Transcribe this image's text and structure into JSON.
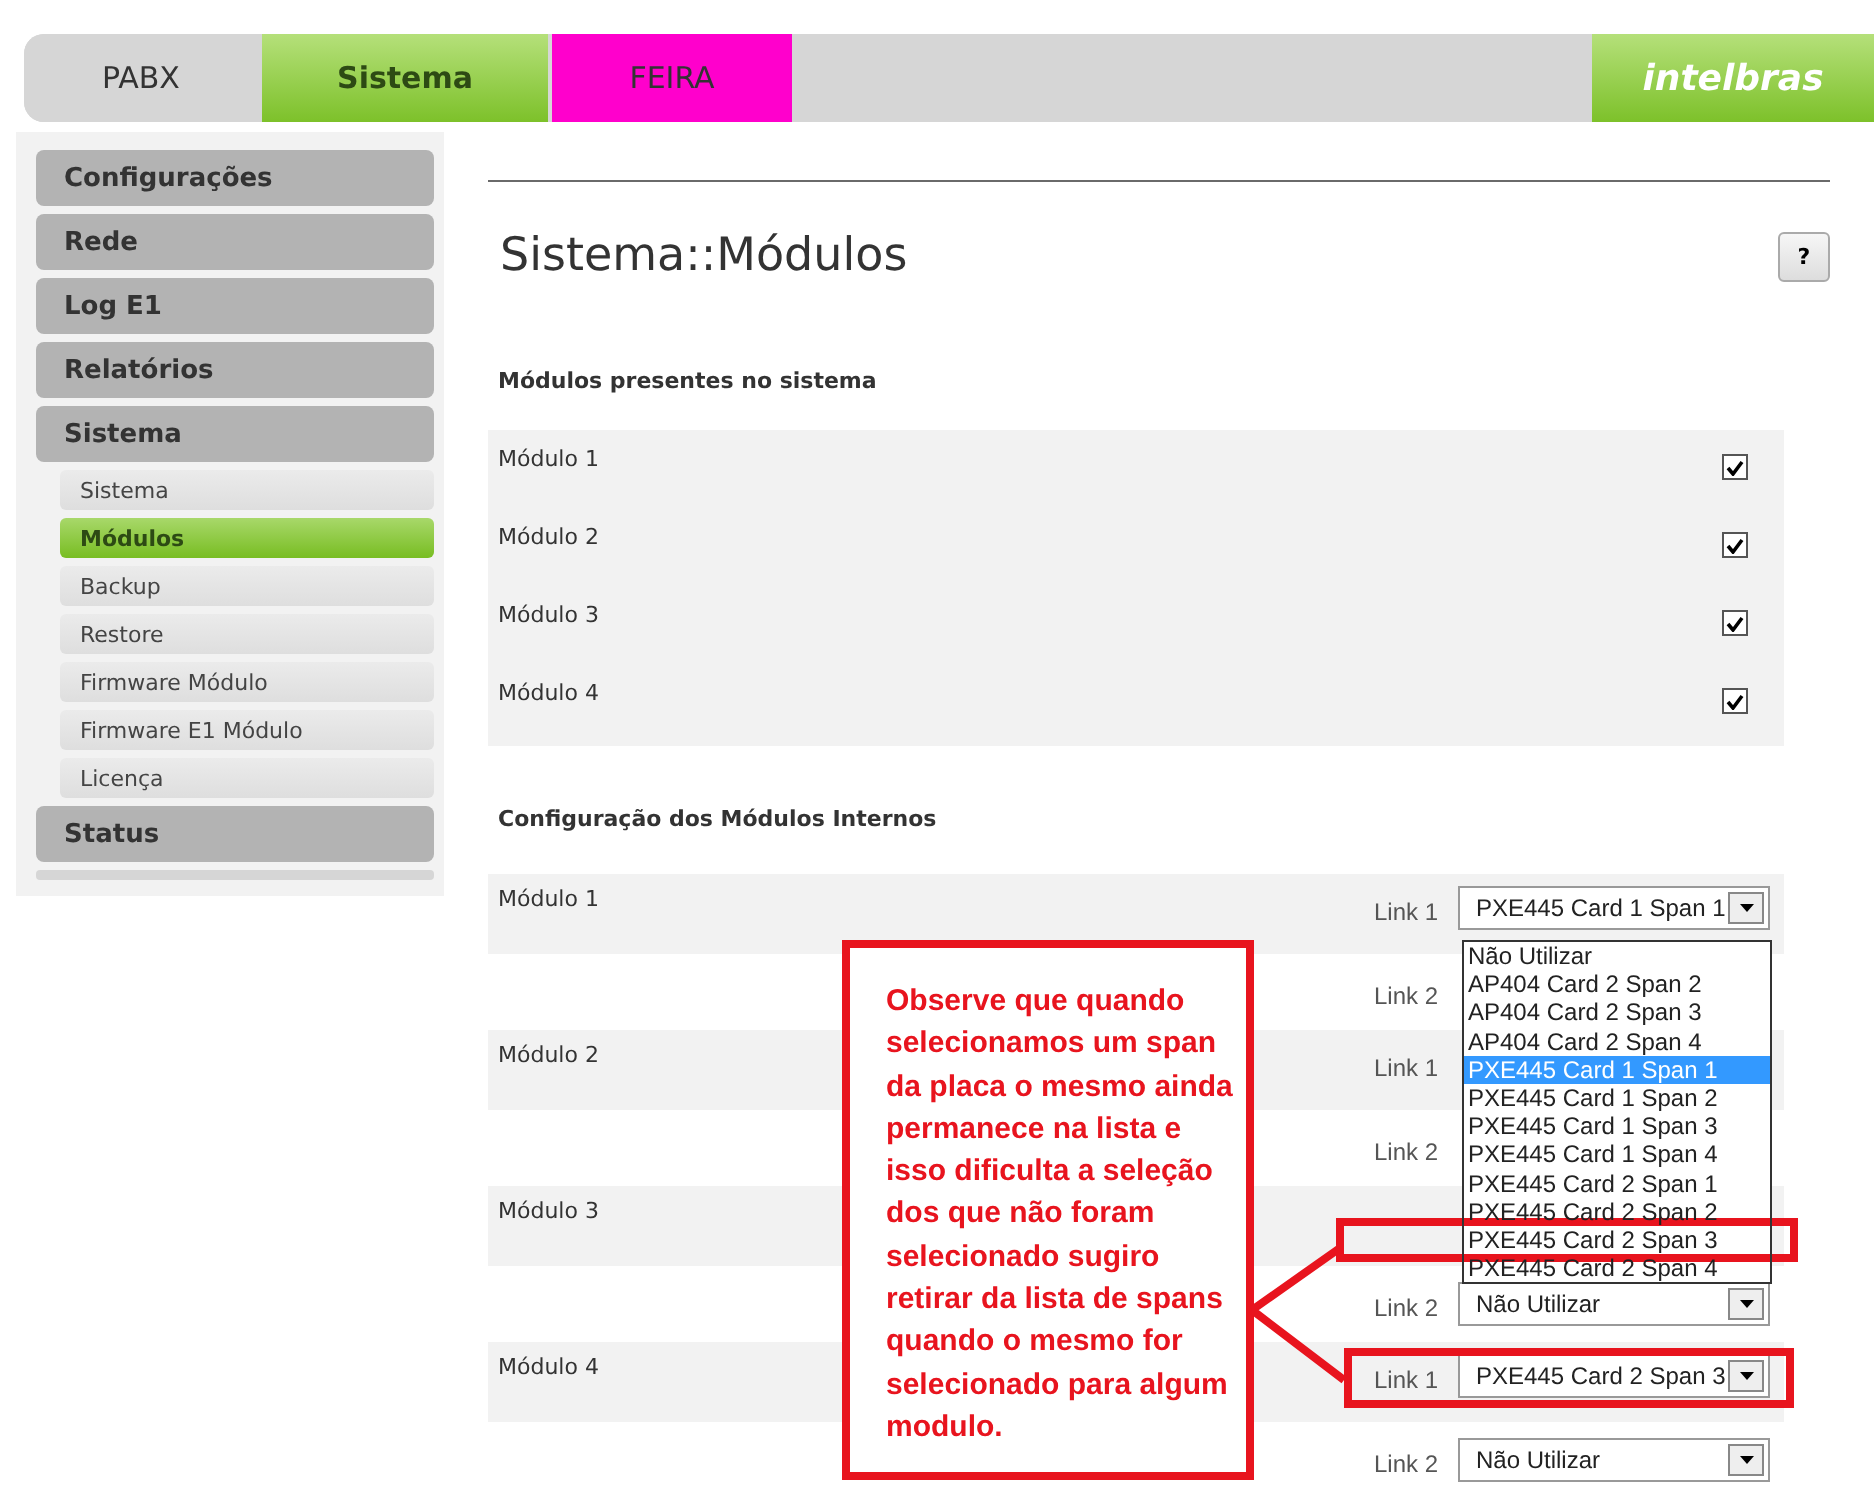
{
  "tabs": [
    {
      "label": "PABX",
      "selected": false,
      "color": "#d6d6d6"
    },
    {
      "label": "Sistema",
      "selected": true,
      "color": "#7dc12a"
    },
    {
      "label": "FEIRA",
      "selected": false,
      "color": "#ff00cc"
    }
  ],
  "logo": "intelbras",
  "sidebar": {
    "items": [
      {
        "label": "Configurações"
      },
      {
        "label": "Rede"
      },
      {
        "label": "Log E1"
      },
      {
        "label": "Relatórios"
      },
      {
        "label": "Sistema",
        "children": [
          {
            "label": "Sistema",
            "selected": false
          },
          {
            "label": "Módulos",
            "selected": true
          },
          {
            "label": "Backup",
            "selected": false
          },
          {
            "label": "Restore",
            "selected": false
          },
          {
            "label": "Firmware Módulo",
            "selected": false
          },
          {
            "label": "Firmware E1 Módulo",
            "selected": false
          },
          {
            "label": "Licença",
            "selected": false
          }
        ]
      },
      {
        "label": "Status"
      }
    ]
  },
  "page": {
    "title": "Sistema::Módulos",
    "help": "?"
  },
  "modules_present": {
    "title": "Módulos presentes no sistema",
    "rows": [
      {
        "label": "Módulo 1",
        "checked": true
      },
      {
        "label": "Módulo 2",
        "checked": true
      },
      {
        "label": "Módulo 3",
        "checked": true
      },
      {
        "label": "Módulo 4",
        "checked": true
      }
    ]
  },
  "internal_config": {
    "title": "Configuração dos Módulos Internos",
    "modules": [
      {
        "label": "Módulo 1",
        "link1": {
          "label": "Link 1",
          "value": "PXE445 Card 1 Span 1"
        },
        "link2": {
          "label": "Link 2"
        }
      },
      {
        "label": "Módulo 2",
        "link1": {
          "label": "Link 1"
        },
        "link2": {
          "label": "Link 2"
        }
      },
      {
        "label": "Módulo 3",
        "link2": {
          "label": "Link 2",
          "value": "Não Utilizar"
        }
      },
      {
        "label": "Módulo 4",
        "link1": {
          "label": "Link 1",
          "value": "PXE445 Card 2 Span 3"
        },
        "link2": {
          "label": "Link 2",
          "value": "Não Utilizar"
        }
      }
    ]
  },
  "dropdown": {
    "options": [
      {
        "label": "Não Utilizar",
        "selected": false
      },
      {
        "label": "AP404 Card 2 Span 2",
        "selected": false
      },
      {
        "label": "AP404 Card 2 Span 3",
        "selected": false
      },
      {
        "label": "AP404 Card 2 Span 4",
        "selected": false
      },
      {
        "label": "PXE445 Card 1 Span 1",
        "selected": true
      },
      {
        "label": "PXE445 Card 1 Span 2",
        "selected": false
      },
      {
        "label": "PXE445 Card 1 Span 3",
        "selected": false
      },
      {
        "label": "PXE445 Card 1 Span 4",
        "selected": false
      },
      {
        "label": "PXE445 Card 2 Span 1",
        "selected": false
      },
      {
        "label": "PXE445 Card 2 Span 2",
        "selected": false
      },
      {
        "label": "PXE445 Card 2 Span 3",
        "selected": false
      },
      {
        "label": "PXE445 Card 2 Span 4",
        "selected": false
      }
    ]
  },
  "annotation": {
    "text": "Observe que quando selecionamos um span da placa o mesmo ainda permanece na lista e isso dificulta a seleção dos que não foram selecionado sugiro retirar da lista de spans quando o mesmo for selecionado para algum modulo."
  }
}
